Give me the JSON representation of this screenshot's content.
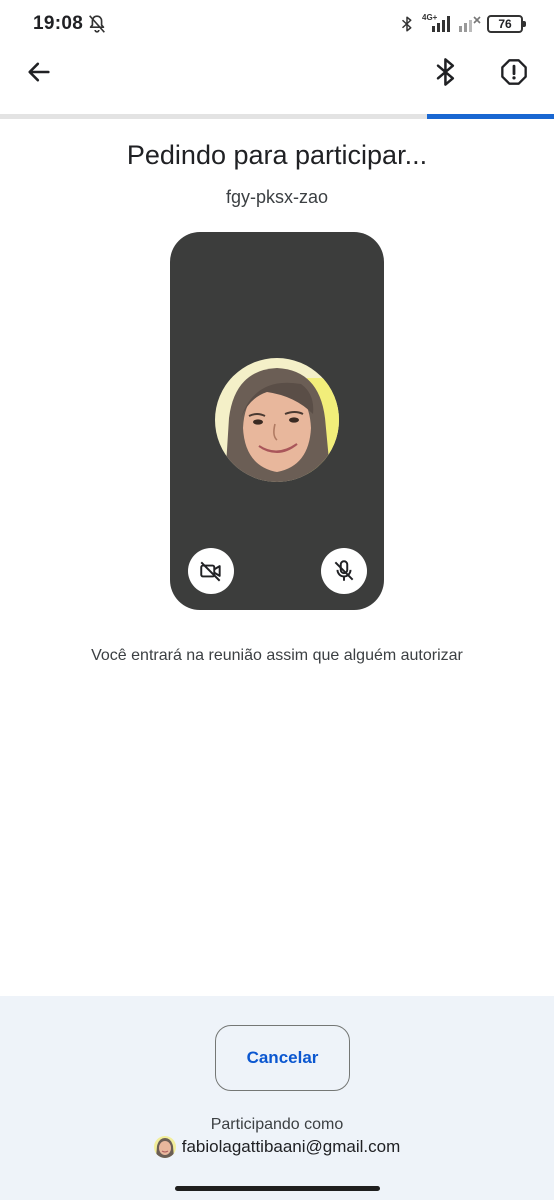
{
  "status_bar": {
    "time": "19:08",
    "network_type": "4G+",
    "battery": "76",
    "icons": [
      "bell-off-icon",
      "bluetooth-icon",
      "signal-icon",
      "signal-no-service-icon",
      "battery-icon"
    ]
  },
  "app_bar": {
    "back_icon": "arrow-back-icon",
    "bluetooth_icon": "bluetooth-icon",
    "report_icon": "report-octagon-icon",
    "progress_fraction": 0.23
  },
  "main": {
    "title": "Pedindo para participar...",
    "meeting_code": "fgy-pksx-zao",
    "preview": {
      "camera_icon": "videocam-off-icon",
      "mic_icon": "mic-off-icon"
    },
    "wait_message": "Você entrará na reunião assim que alguém autorizar"
  },
  "footer": {
    "cancel_label": "Cancelar",
    "participating_label": "Participando como",
    "account_email": "fabiolagattibaani@gmail.com"
  },
  "colors": {
    "accent": "#1967d2",
    "preview_bg": "#3c3d3c",
    "panel_bg": "#eef3f9",
    "button_text": "#0b57d0"
  }
}
